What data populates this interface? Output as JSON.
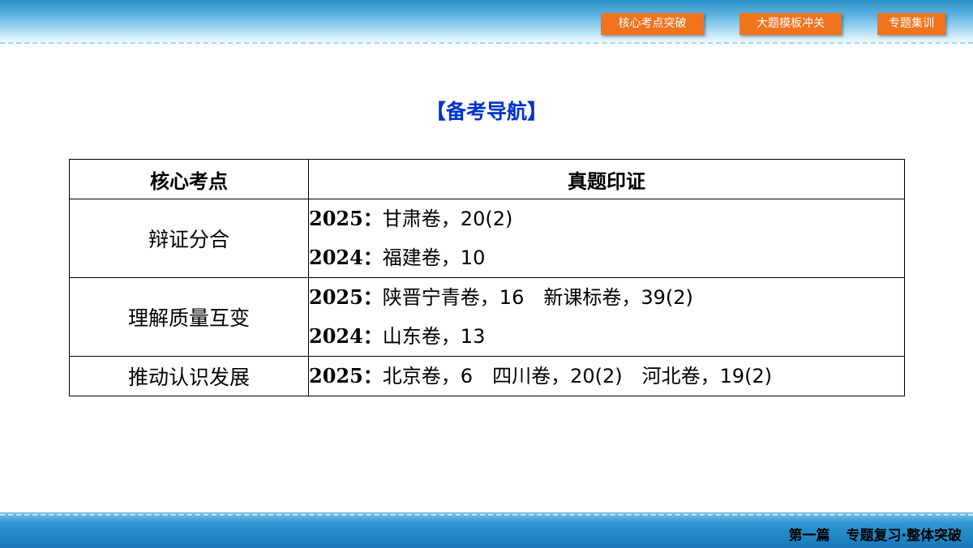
{
  "nav": {
    "items": [
      {
        "label": "核心考点突破"
      },
      {
        "label": "大题模板冲关"
      },
      {
        "label": "专题集训"
      }
    ]
  },
  "heading": "【备考导航】",
  "table": {
    "headers": [
      "核心考点",
      "真题印证"
    ],
    "rows": [
      {
        "topic": "辩证分合",
        "lines": [
          {
            "year": "2025：",
            "text": "甘肃卷，20(2)"
          },
          {
            "year": "2024：",
            "text": "福建卷，10"
          }
        ]
      },
      {
        "topic": "理解质量互变",
        "lines": [
          {
            "year": "2025：",
            "text": "陕晋宁青卷，16　新课标卷，39(2)"
          },
          {
            "year": "2024：",
            "text": "山东卷，13"
          }
        ]
      },
      {
        "topic": "推动认识发展",
        "lines": [
          {
            "year": "2025：",
            "text": "北京卷，6　四川卷，20(2)　河北卷，19(2)"
          }
        ]
      }
    ]
  },
  "footer": {
    "part": "第一篇",
    "title": "专题复习·整体突破"
  }
}
